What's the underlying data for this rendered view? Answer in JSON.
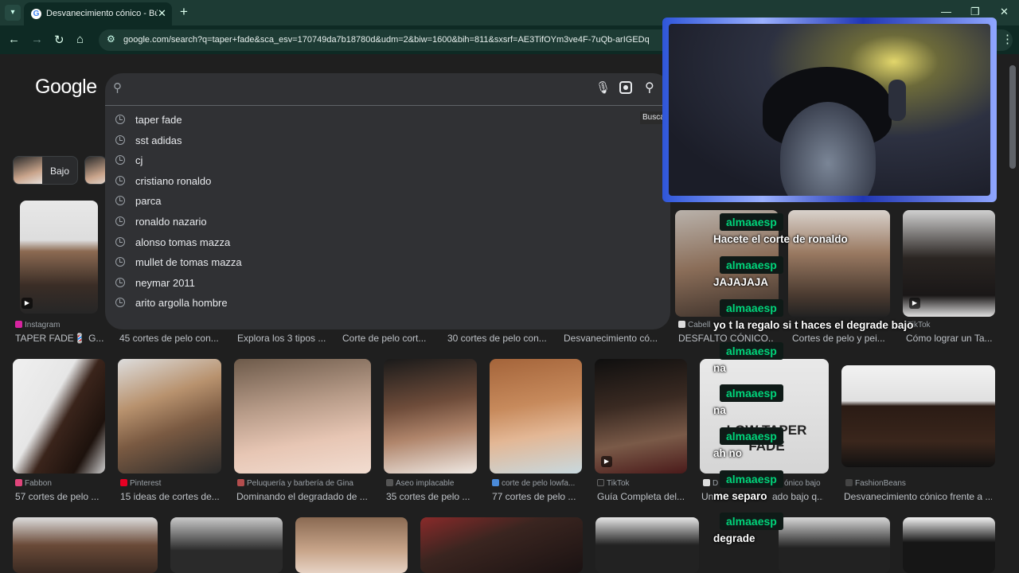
{
  "browser": {
    "tab_title": "Desvanecimiento cónico - Búsq",
    "new_tab": "+",
    "url": "google.com/search?q=taper+fade&sca_esv=170749da7b18780d&udm=2&biw=1600&bih=811&sxsrf=AE3TifOYm3ve4F-7uQb-arIGEDq"
  },
  "google": {
    "logo": "Google",
    "search_value": "",
    "tooltip": "Buscar",
    "suggestions": [
      "taper fade",
      "sst adidas",
      "cj",
      "cristiano ronaldo",
      "parca",
      "ronaldo nazario",
      "alonso tomas mazza",
      "mullet de tomas mazza",
      "neymar 2011",
      "arito argolla hombre"
    ]
  },
  "chips": [
    {
      "label": "Bajo"
    }
  ],
  "results_row1": [
    {
      "source": "Instagram",
      "caption": "TAPER FADE💈 G..."
    },
    {
      "source": "",
      "caption": "45 cortes de pelo con..."
    },
    {
      "source": "",
      "caption": "Explora los 3 tipos ..."
    },
    {
      "source": "",
      "caption": "Corte de pelo cort..."
    },
    {
      "source": "",
      "caption": "30 cortes de pelo con..."
    },
    {
      "source": "",
      "caption": "Desvanecimiento có..."
    },
    {
      "source": "Cabell",
      "caption": "DESFALTO CÓNICO..."
    },
    {
      "source": "",
      "caption": "Cortes de pelo y pei..."
    },
    {
      "source": "TikTok",
      "caption": "Cómo lograr un Ta..."
    }
  ],
  "results_row2": [
    {
      "source": "Fabbon",
      "caption": "57 cortes de pelo ...",
      "color": "#e0457b"
    },
    {
      "source": "Pinterest",
      "caption": "15 ideas de cortes de...",
      "color": "#e60023"
    },
    {
      "source": "Peluquería y barbería de Gina",
      "caption": "Dominando el degradado de ...",
      "color": "#b34d4d"
    },
    {
      "source": "Aseo implacable",
      "caption": "35 cortes de pelo ...",
      "color": "#555555"
    },
    {
      "source": "corte de pelo lowfa...",
      "caption": "77 cortes de pelo ...",
      "color": "#4a8ad9"
    },
    {
      "source": "TikTok",
      "caption": "Guía Completa del...",
      "color": "#222222"
    },
    {
      "source": "D",
      "caption": "Un",
      "color": "#dddddd"
    },
    {
      "source": "ónico bajo",
      "caption": "ado bajo q...",
      "color": "#1f1f1f"
    },
    {
      "source": "FashionBeans",
      "caption": "Desvanecimiento cónico frente a ...",
      "color": "#444444"
    }
  ],
  "overlay_text": "LOW TAPER FADE",
  "chat": [
    {
      "user": "almaaesp",
      "text": "Hacete el corte de ronaldo"
    },
    {
      "user": "almaaesp",
      "text": "JAJAJAJA"
    },
    {
      "user": "almaaesp",
      "text": "yo t la regalo si t haces el degrade bajo"
    },
    {
      "user": "almaaesp",
      "text": "na"
    },
    {
      "user": "almaaesp",
      "text": "na"
    },
    {
      "user": "almaaesp",
      "text": "ah no"
    },
    {
      "user": "almaaesp",
      "text": "me separo"
    },
    {
      "user": "almaaesp",
      "text": "degrade"
    }
  ]
}
